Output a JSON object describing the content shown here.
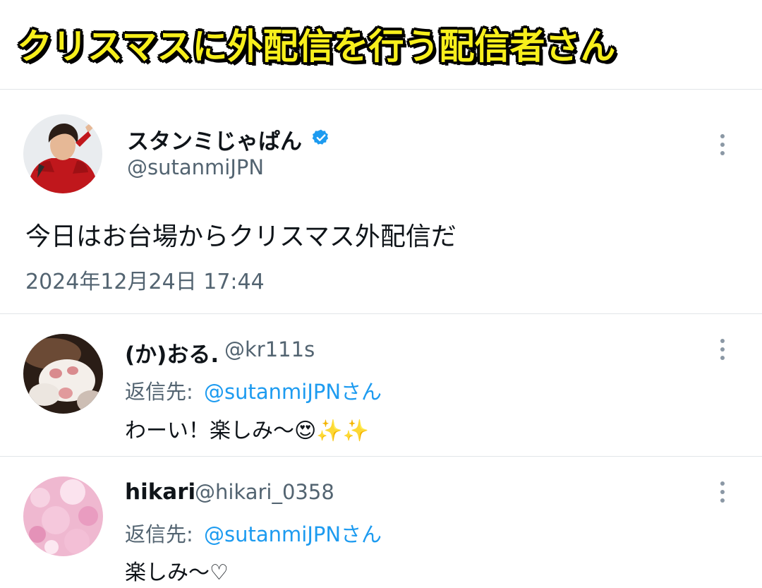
{
  "banner": {
    "title": "クリスマスに外配信を行う配信者さん"
  },
  "main_tweet": {
    "display_name": "スタンミじゃぱん",
    "handle": "@sutanmiJPN",
    "verified": true,
    "text": "今日はお台場からクリスマス外配信だ",
    "timestamp": "2024年12月24日 17:44"
  },
  "replies": [
    {
      "display_name": "(か)おる.",
      "handle": "@kr111s",
      "reply_prefix": "返信先:",
      "reply_to": "@sutanmiJPNさん",
      "text": "わーい！楽しみ〜",
      "emoji": "😍✨✨"
    },
    {
      "display_name": "hikari",
      "handle": "@hikari_0358",
      "reply_prefix": "返信先:",
      "reply_to": "@sutanmiJPNさん",
      "text": "楽しみ〜♡"
    }
  ],
  "colors": {
    "banner_text": "#f7ef1c",
    "verified_badge": "#1d9bf0",
    "link": "#1d9bf0",
    "muted": "#536471"
  },
  "icons": [
    "verified-badge-icon",
    "more-options-icon"
  ]
}
